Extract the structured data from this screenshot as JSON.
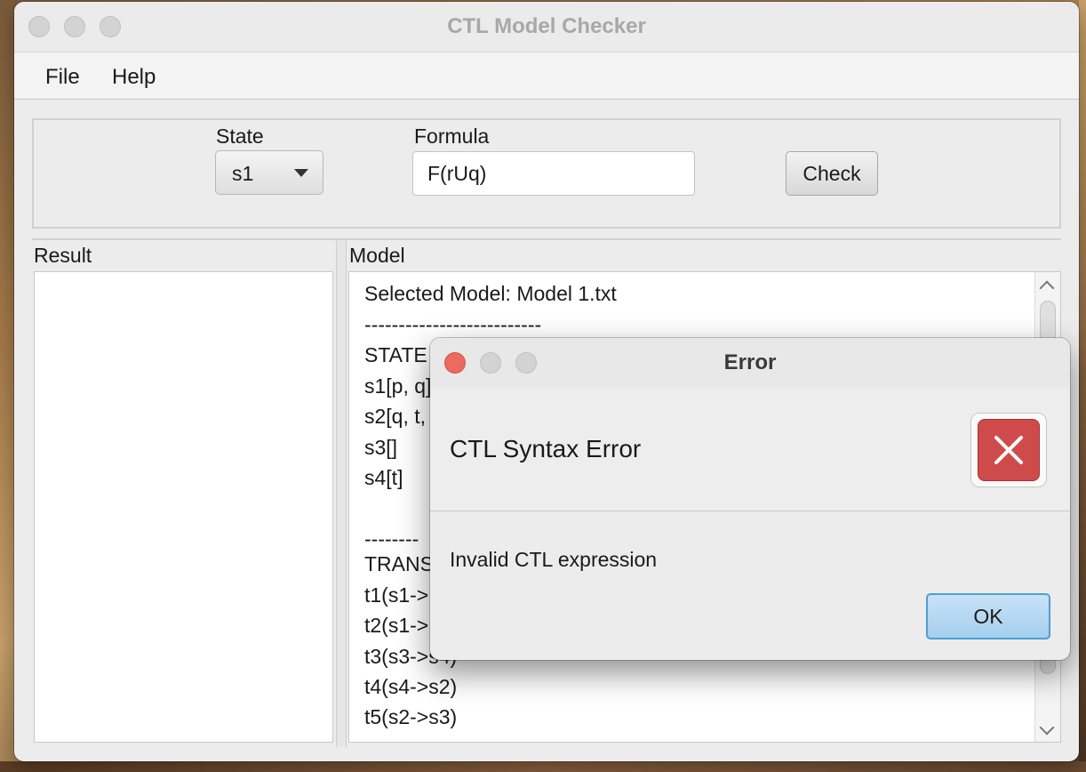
{
  "window": {
    "title": "CTL Model Checker"
  },
  "menu": {
    "items": [
      "File",
      "Help"
    ]
  },
  "controls": {
    "state_label": "State",
    "state_value": "s1",
    "formula_label": "Formula",
    "formula_value": "F(rUq)",
    "check_label": "Check"
  },
  "panes": {
    "result_label": "Result",
    "model_label": "Model"
  },
  "model_text": [
    "Selected Model: Model 1.txt",
    "--------------------------",
    "STATE",
    "s1[p, q]",
    "s2[q, t,",
    "s3[]",
    "s4[t]",
    "",
    "--------",
    "TRANS",
    "t1(s1->",
    "t2(s1->",
    "t3(s3->s4)",
    "t4(s4->s2)",
    "t5(s2->s3)"
  ],
  "dialog": {
    "title": "Error",
    "header": "CTL Syntax Error",
    "message": "Invalid CTL expression",
    "ok_label": "OK",
    "icon": "error-x-icon",
    "close_color": "#ed6a5e"
  }
}
